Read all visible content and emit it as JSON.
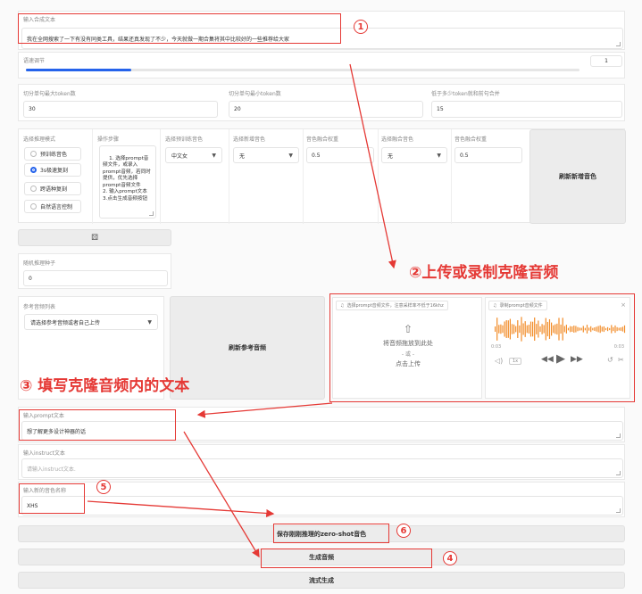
{
  "tts": {
    "label": "输入合成文本",
    "value": "我在全网搜索了一下有没有同类工具，结果还真发现了不少，今天就做一期合集将其中比较好的一些推荐给大家"
  },
  "speed": {
    "label": "语速调节",
    "value": "1",
    "fraction": 0.19
  },
  "tokens": [
    {
      "label": "切分单句最大token数",
      "value": "30"
    },
    {
      "label": "切分单句最小token数",
      "value": "20"
    },
    {
      "label": "低于多少token就和前句合并",
      "value": "15"
    }
  ],
  "mode": {
    "label": "选择推理模式",
    "options": [
      "预训练音色",
      "3s极速复刻",
      "跨语种复刻",
      "自然语言控制"
    ],
    "selected": 1
  },
  "steps": {
    "label": "操作步骤",
    "text": "1. 选择prompt音频文件，或录入prompt音频，若同时提供，优先选择prompt音频文件\n2. 输入prompt文本\n3.点击生成音频按钮"
  },
  "pretrained_voice": {
    "label": "选择预训练音色",
    "value": "中文女"
  },
  "new_voice1": {
    "label": "选择新增音色",
    "value": "无"
  },
  "weight1": {
    "label": "音色融合权重",
    "value": "0.5"
  },
  "fuse_voice": {
    "label": "选择融合音色",
    "value": "无"
  },
  "weight2": {
    "label": "音色融合权重",
    "value": "0.5"
  },
  "refresh_new_voice": "刷新新增音色",
  "seed": {
    "label": "随机推理种子",
    "value": "0"
  },
  "ref_audio": {
    "label": "参考音频列表",
    "value": "请选择参考音频或者自己上传"
  },
  "refresh_ref_audio": "刷新参考音频",
  "upload": {
    "tab_label": "选择prompt音频文件，注意采样率不低于16khz",
    "drop_text": "将音频拖放到此处",
    "or_text": "- 或 -",
    "click_text": "点击上传"
  },
  "record": {
    "tab_label": "录制prompt音频文件",
    "time_start": "0:03",
    "time_end": "0:03",
    "speed_label": "1x"
  },
  "prompt_text": {
    "label": "输入prompt文本",
    "value": "想了解更多设计神器的话"
  },
  "instruct": {
    "label": "输入instruct文本",
    "placeholder": "请输入instruct文本."
  },
  "new_voice_name": {
    "label": "输入新的音色名称",
    "value": "XHS"
  },
  "buttons": {
    "save": "保存刚刚推理的zero-shot音色",
    "generate": "生成音频",
    "stream": "流式生成"
  },
  "annotations": {
    "upload": "②上传或录制克隆音频",
    "fill_text": "③ 填写克隆音频内的文本",
    "n1": "1",
    "n4": "4",
    "n5": "5",
    "n6": "6"
  },
  "colors": {
    "accent": "#2563eb",
    "annotation": "#e53935"
  }
}
